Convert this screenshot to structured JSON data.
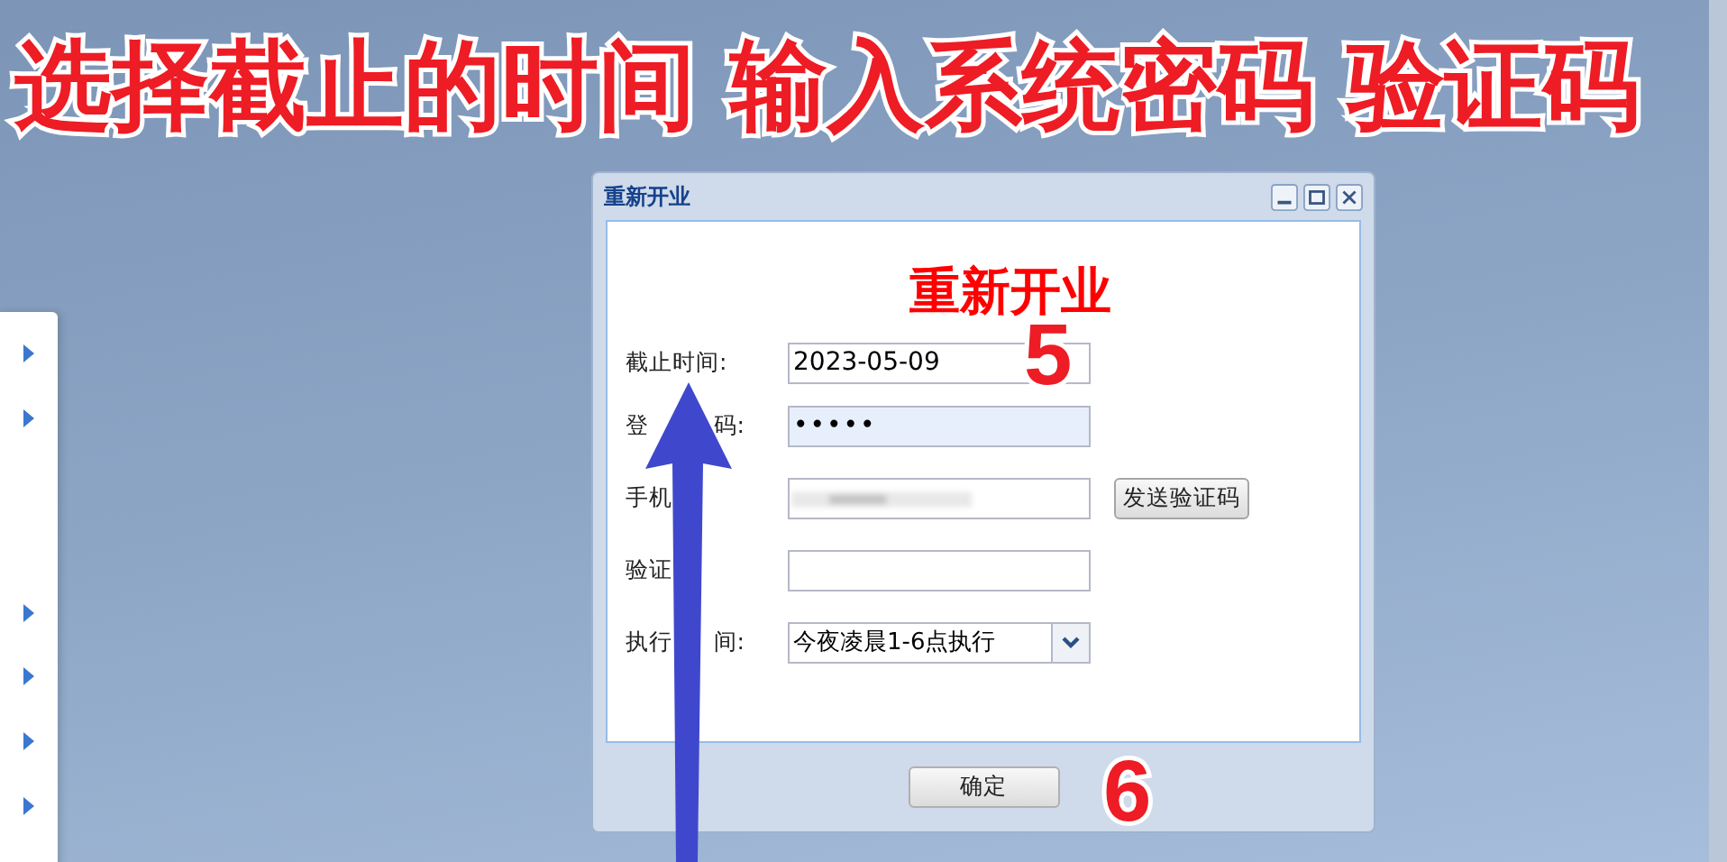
{
  "banner": "选择截止的时间 输入系统密码 验证码",
  "window": {
    "title": "重新开业",
    "heading": "重新开业"
  },
  "form": [
    {
      "kind": "text",
      "label": [
        "截止时间:"
      ],
      "value": "2023-05-09"
    },
    {
      "kind": "password",
      "label": [
        "登",
        "码:"
      ],
      "value": "•••••"
    },
    {
      "kind": "blurred",
      "label": [
        "手机"
      ],
      "button": "发送验证码"
    },
    {
      "kind": "empty",
      "label": [
        "验证"
      ]
    },
    {
      "kind": "select",
      "label": [
        "执行",
        "间:"
      ],
      "value": "今夜凌晨1-6点执行"
    }
  ],
  "ok_button": "确定",
  "callouts": [
    "5",
    "6"
  ]
}
